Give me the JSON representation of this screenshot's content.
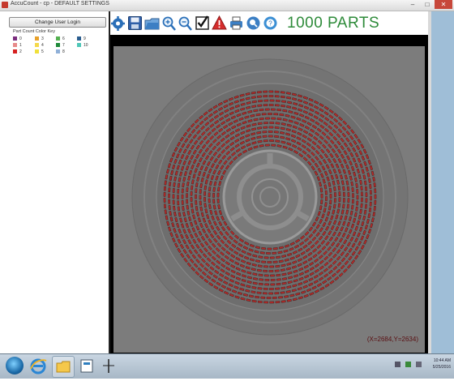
{
  "window": {
    "title": "AccuCount - cp - DEFAULT SETTINGS",
    "buttons": {
      "minimize": "–",
      "maximize": "□",
      "close": "✕"
    }
  },
  "sidebar": {
    "change_user_label": "Change User Login",
    "key_title": "Part Count Color Key",
    "key": [
      {
        "label": "0",
        "color": "#7b2d7e"
      },
      {
        "label": "1",
        "color": "#e78a8a"
      },
      {
        "label": "2",
        "color": "#d62020"
      },
      {
        "label": "3",
        "color": "#e8a12a"
      },
      {
        "label": "4",
        "color": "#f5d94a"
      },
      {
        "label": "5",
        "color": "#f0e03a"
      },
      {
        "label": "6",
        "color": "#53b04f"
      },
      {
        "label": "7",
        "color": "#1f8a3a"
      },
      {
        "label": "8",
        "color": "#8fb0d8"
      },
      {
        "label": "9",
        "color": "#2a5d8f"
      },
      {
        "label": "10",
        "color": "#4fc7b8"
      }
    ]
  },
  "toolbar": {
    "tools": [
      "settings-icon",
      "save-icon",
      "open-folder-icon",
      "zoom-in-icon",
      "zoom-out-icon",
      "checkmark-icon",
      "warning-icon",
      "print-icon",
      "search-icon",
      "help-icon"
    ],
    "parts_count": "1000 PARTS"
  },
  "canvas": {
    "coordinates": "(X=2684,Y=2634)",
    "reel_mark_color": "#b52a28"
  },
  "taskbar": {
    "apps": [
      "start-orb",
      "ie-icon",
      "explorer-folder-icon",
      "accucount-app-icon",
      "cursor-app-icon"
    ],
    "time": "10:44 AM",
    "date": "5/25/2016"
  }
}
